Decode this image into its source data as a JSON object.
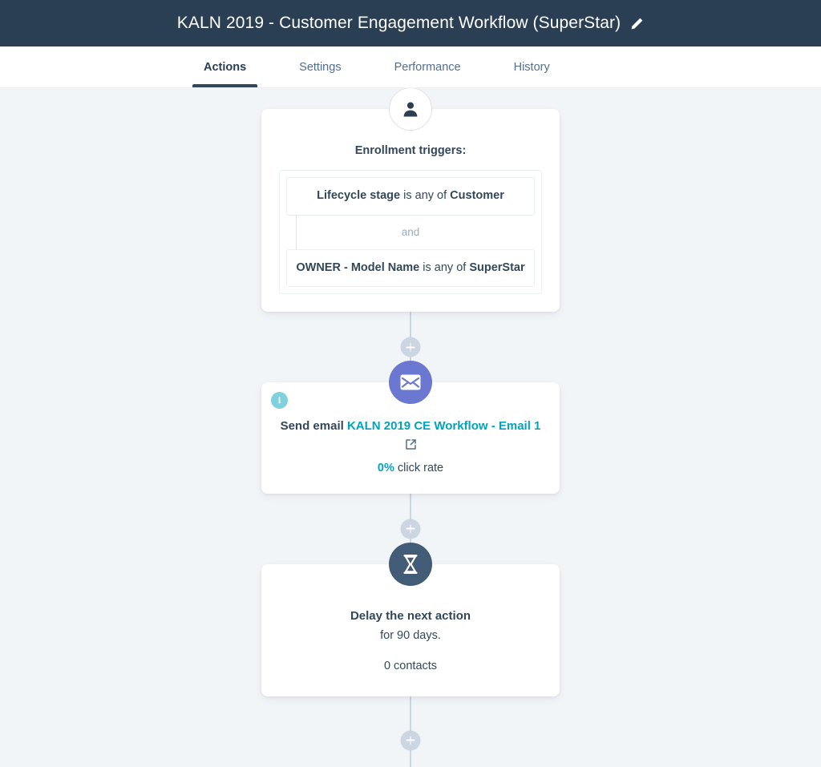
{
  "header": {
    "title": "KALN 2019 - Customer Engagement Workflow (SuperStar)",
    "edit_icon": "pencil-icon",
    "background_color": "#2a3f54"
  },
  "tabs": [
    {
      "label": "Actions",
      "active": true
    },
    {
      "label": "Settings",
      "active": false
    },
    {
      "label": "Performance",
      "active": false
    },
    {
      "label": "History",
      "active": false
    }
  ],
  "colors": {
    "canvas_background": "#f2f5f8",
    "header_background": "#2a3f54",
    "text_primary": "#33475b",
    "accent_teal": "#00a4bd",
    "email_node": "#6a78d1",
    "delay_node": "#425b76",
    "connector_line": "#cbd6e2",
    "info_badge": "#7fd1de"
  },
  "flow": {
    "enrollment": {
      "icon": "contact-person-icon",
      "heading": "Enrollment triggers:",
      "filters": [
        {
          "property": "Lifecycle stage",
          "operator": "is any of",
          "value": "Customer"
        },
        {
          "property": "OWNER - Model Name",
          "operator": "is any of",
          "value": "SuperStar"
        }
      ],
      "join_label": "and"
    },
    "email_action": {
      "icon": "envelope-icon",
      "info_badge": "info-icon",
      "info_badge_glyph": "i",
      "prefix": "Send email ",
      "email_name": "KALN 2019 CE Workflow - Email 1",
      "external_link_icon": "external-link-icon",
      "stat_value": "0%",
      "stat_label": " click rate"
    },
    "delay_action": {
      "icon": "hourglass-icon",
      "title": "Delay the next action",
      "subtitle": "for 90 days.",
      "contacts": "0 contacts"
    },
    "add_step_label": "+"
  }
}
